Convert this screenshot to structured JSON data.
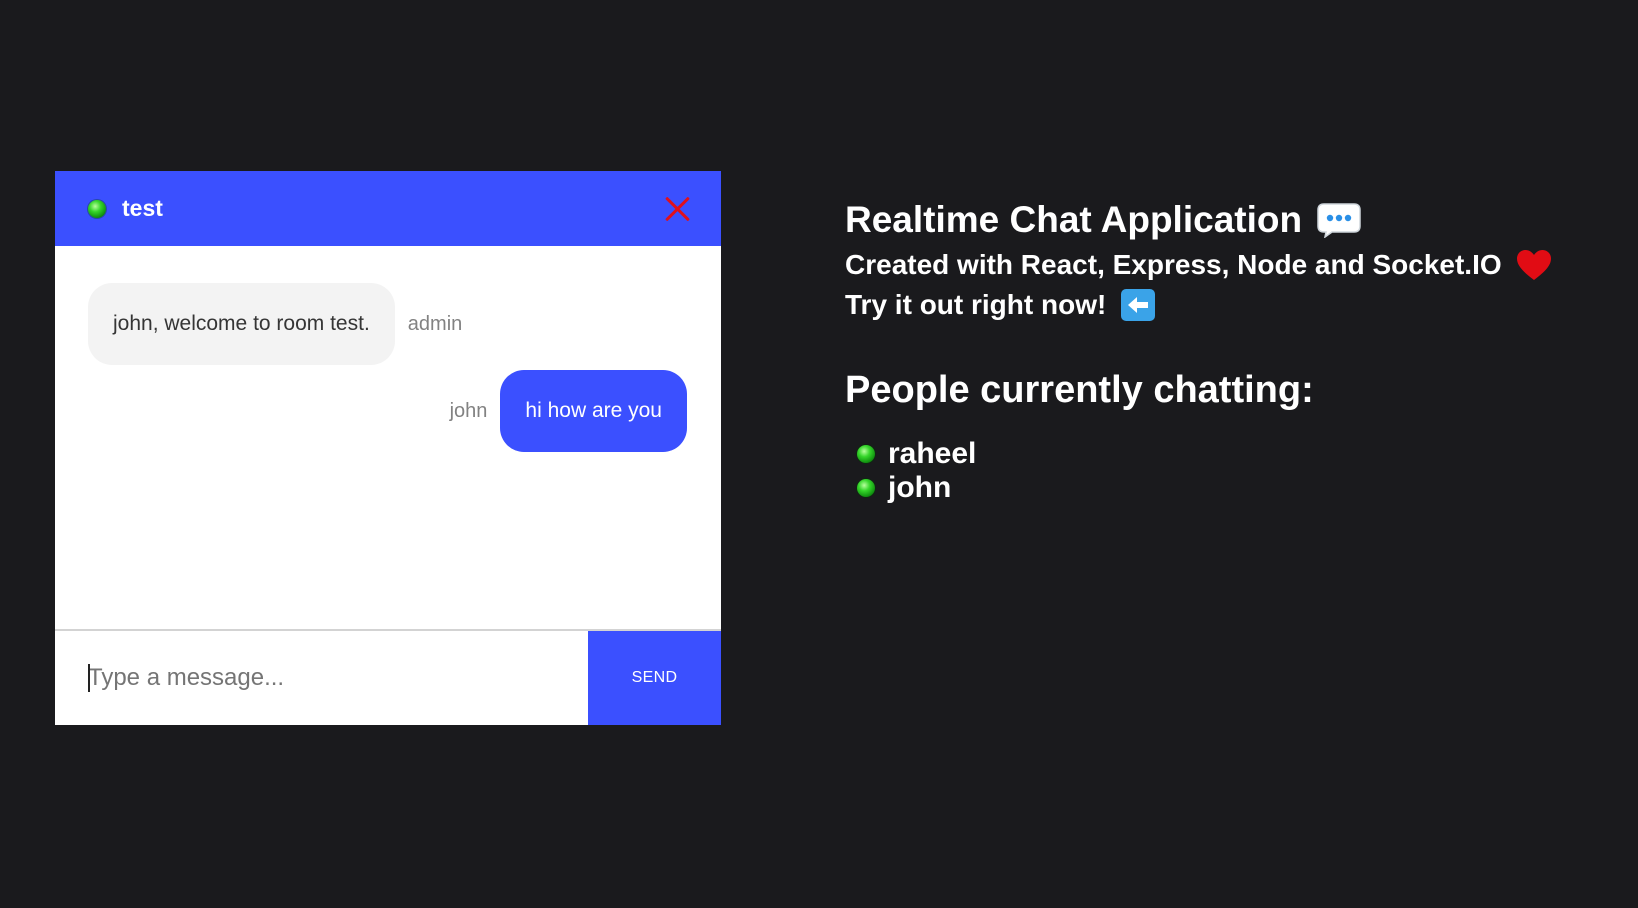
{
  "chat": {
    "room_name": "test",
    "messages": [
      {
        "text": "john, welcome to room test.",
        "sender": "admin",
        "side": "left"
      },
      {
        "text": "hi how are you",
        "sender": "john",
        "side": "right"
      }
    ],
    "input_placeholder": "Type a message...",
    "input_value": "",
    "send_label": "SEND"
  },
  "info": {
    "title": "Realtime Chat Application",
    "subtitle": "Created with React, Express, Node and Socket.IO",
    "cta": "Try it out right now!",
    "people_heading": "People currently chatting:",
    "people": [
      "raheel",
      "john"
    ],
    "icons": {
      "title_icon": "speech-bubble-icon",
      "subtitle_icon": "heart-icon",
      "cta_icon": "left-arrow-icon",
      "status_icon": "online-dot-icon"
    }
  },
  "colors": {
    "background": "#1a1a1d",
    "accent": "#3b50ff",
    "close": "#e0101c",
    "bubble_light": "#f3f3f3",
    "online": "#35d62a"
  }
}
